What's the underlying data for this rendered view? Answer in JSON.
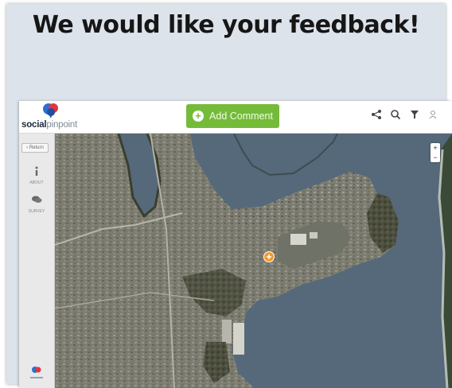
{
  "headline": "We would like your feedback!",
  "app": {
    "logo": {
      "text_bold": "social",
      "text_light": "pinpoint"
    },
    "add_comment_label": "Add Comment",
    "toolbar_icons": [
      "share-icon",
      "search-icon",
      "filter-icon",
      "user-icon"
    ],
    "sidebar": {
      "return_label": "‹ Return",
      "items": [
        {
          "icon": "info-icon",
          "label": "ABOUT"
        },
        {
          "icon": "comments-icon",
          "label": "SURVEY"
        }
      ],
      "footer_logo": "socialpinpoint"
    },
    "map": {
      "type": "satellite",
      "zoom_in": "+",
      "zoom_out": "−",
      "comment_pins": 1
    }
  },
  "colors": {
    "accent_green": "#74bb3a",
    "pin_orange": "#f39a2b",
    "logo_blue": "#2c6fcf",
    "logo_red": "#e0373d"
  }
}
